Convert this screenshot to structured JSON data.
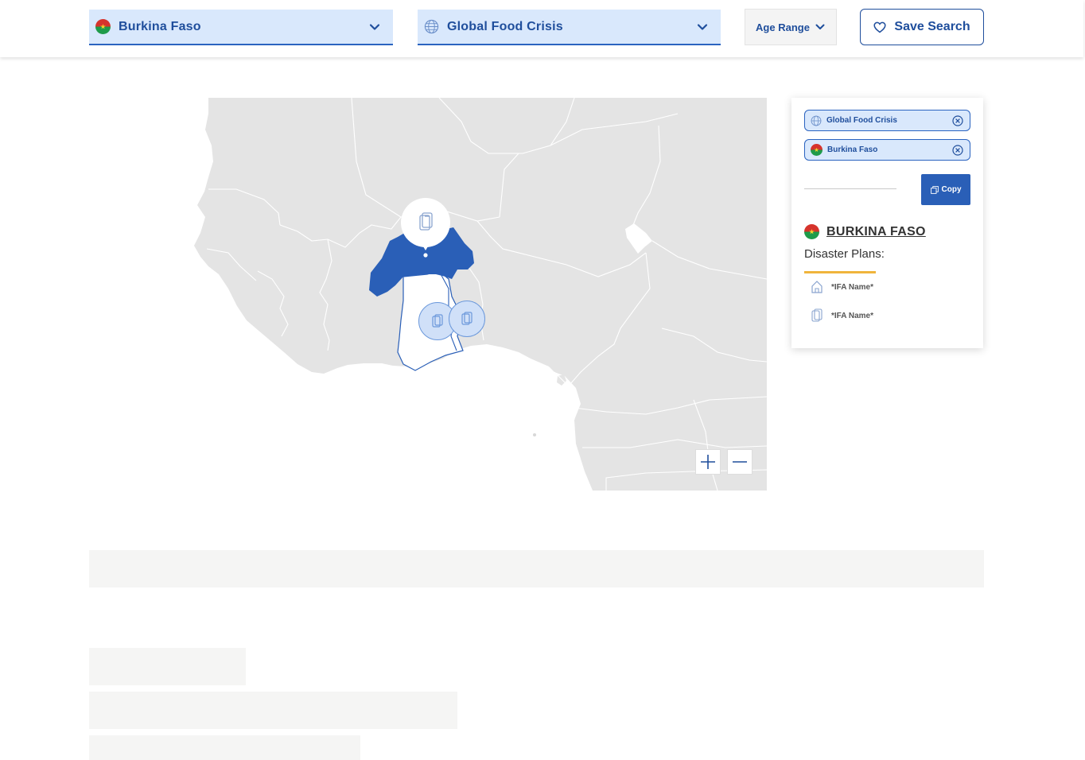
{
  "filters": {
    "country": {
      "label": "Burkina Faso",
      "icon": "burkina-faso-flag-icon"
    },
    "crisis": {
      "label": "Global Food Crisis",
      "icon": "globe-icon"
    },
    "age_range": {
      "label": "Age Range"
    },
    "save_search": {
      "label": "Save Search",
      "icon": "heart-icon"
    }
  },
  "panel": {
    "chips": [
      {
        "label": "Global Food Crisis",
        "icon": "globe-icon"
      },
      {
        "label": "Burkina Faso",
        "icon": "burkina-faso-flag-icon"
      }
    ],
    "copy_label": "Copy",
    "country_name": "BURKINA FASO",
    "plans_label": "Disaster Plans:",
    "plans": [
      {
        "name": "*IFA Name*",
        "icon": "house-icon"
      },
      {
        "name": "*IFA Name*",
        "icon": "phone-icon"
      }
    ]
  },
  "colors": {
    "accent": "#1f4e9c",
    "chip_bg": "#d9e8fc",
    "highlight_country": "#2a5fb7",
    "land": "#e4e4e4",
    "rule": "#f0b43c"
  }
}
